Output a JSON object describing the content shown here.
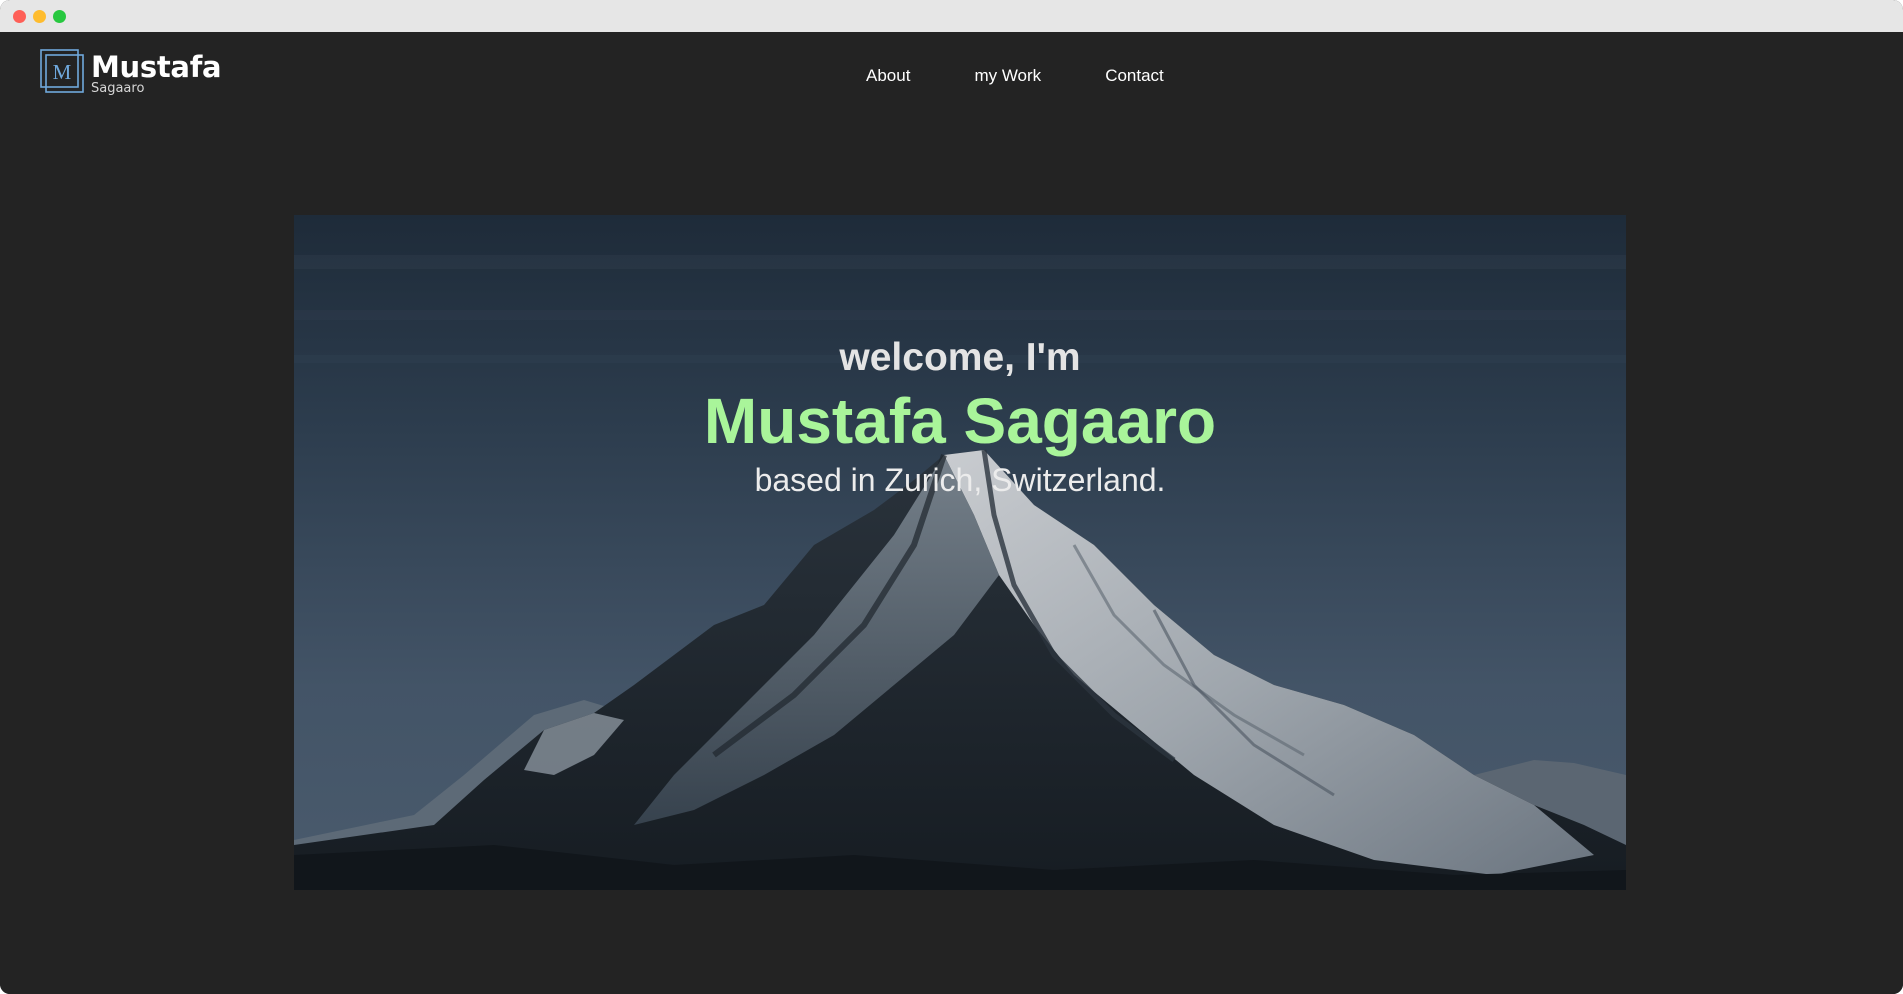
{
  "logo": {
    "mark_letter": "M",
    "title": "Mustafa",
    "subtitle": "Sagaaro"
  },
  "nav": {
    "items": [
      "About",
      "my Work",
      "Contact"
    ]
  },
  "hero": {
    "welcome": "welcome, I'm",
    "name": "Mustafa Sagaaro",
    "location": "based in Zurich, Switzerland."
  },
  "colors": {
    "page_background": "#232323",
    "accent_name": "#a9f59a",
    "logo_mark": "#6fa8dc",
    "text": "#ffffff"
  }
}
